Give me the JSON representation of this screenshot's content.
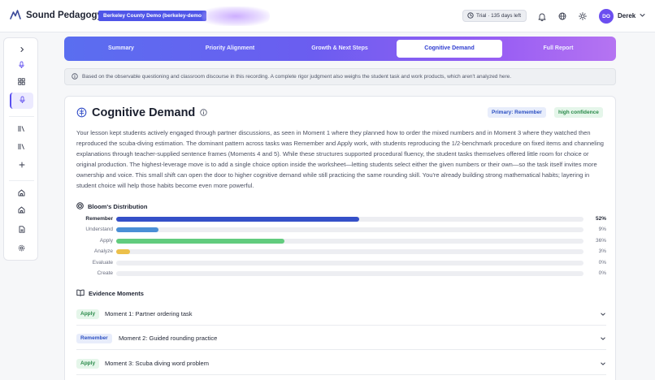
{
  "header": {
    "brand": "Sound Pedagogy",
    "org": "Berkeley County Demo (berkeley-demo",
    "trial": "Trial · 135 days left",
    "user_initials": "DO",
    "user_name": "Derek"
  },
  "tabs": [
    {
      "label": "Summary"
    },
    {
      "label": "Priority Alignment"
    },
    {
      "label": "Growth & Next Steps"
    },
    {
      "label": "Cognitive Demand",
      "active": true
    },
    {
      "label": "Full Report"
    }
  ],
  "info_banner": "Based on the observable questioning and classroom discourse in this recording. A complete rigor judgment also weighs the student task and work products, which aren't analyzed here.",
  "card": {
    "title": "Cognitive Demand",
    "primary_badge": "Primary: Remember",
    "confidence_badge": "high confidence",
    "summary": "Your lesson kept students actively engaged through partner discussions, as seen in Moment 1 where they planned how to order the mixed numbers and in Moment 3 where they watched then reproduced the scuba-diving estimation. The dominant pattern across tasks was Remember and Apply work, with students reproducing the 1/2-benchmark procedure on fixed items and channeling explanations through teacher-supplied sentence frames (Moments 4 and 5). While these structures supported procedural fluency, the student tasks themselves offered little room for choice or original production. The highest-leverage move is to add a single choice option inside the worksheet—letting students select either the given numbers or their own—so the task itself invites more ownership and voice. This small shift can open the door to higher cognitive demand while still practicing the same rounding skill. You're already building strong mathematical habits; layering in student choice will help those habits become even more powerful."
  },
  "bloom": {
    "title": "Bloom's Distribution",
    "levels": [
      {
        "label": "Remember",
        "percent": 52,
        "display": "52%",
        "color": "#3550c8",
        "strong": true
      },
      {
        "label": "Understand",
        "percent": 9,
        "display": "9%",
        "color": "#4a8fd6"
      },
      {
        "label": "Apply",
        "percent": 36,
        "display": "36%",
        "color": "#62cc7e"
      },
      {
        "label": "Analyze",
        "percent": 3,
        "display": "3%",
        "color": "#ecc04a"
      },
      {
        "label": "Evaluate",
        "percent": 0,
        "display": "0%",
        "color": "#c07ad8"
      },
      {
        "label": "Create",
        "percent": 0,
        "display": "0%",
        "color": "#e0708a"
      }
    ]
  },
  "evidence": {
    "title": "Evidence Moments",
    "moments": [
      {
        "tag": "Apply",
        "title": "Moment 1: Partner ordering task"
      },
      {
        "tag": "Remember",
        "title": "Moment 2: Guided rounding practice"
      },
      {
        "tag": "Apply",
        "title": "Moment 3: Scuba diving word problem"
      }
    ]
  },
  "icons": {
    "brand": "wave-logo-icon",
    "trial": "clock-icon",
    "notifications": "bell-icon",
    "language": "globe-icon",
    "theme": "sun-icon",
    "user_menu": "chevron-down-icon",
    "info": "info-icon",
    "title": "brain-icon",
    "title_help": "info-circle-icon",
    "bloom": "target-icon",
    "evidence": "book-open-icon"
  },
  "colors": {
    "accent": "#4f55e8",
    "tab_gradient_start": "#5a6ef0",
    "tab_gradient_end": "#b574f2"
  }
}
